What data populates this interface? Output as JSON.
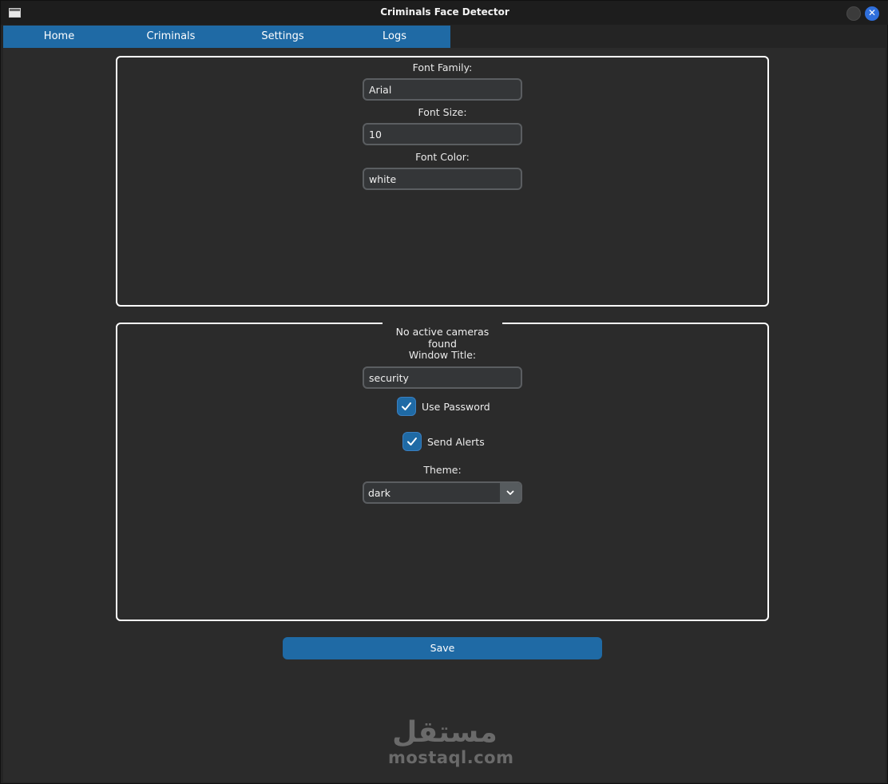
{
  "window": {
    "title": "Criminals Face Detector"
  },
  "tabs": [
    {
      "label": "Home"
    },
    {
      "label": "Criminals"
    },
    {
      "label": "Settings"
    },
    {
      "label": "Logs"
    }
  ],
  "font_settings": {
    "family_label": "Font Family:",
    "family_value": "Arial",
    "size_label": "Font Size:",
    "size_value": "10",
    "color_label": "Font Color:",
    "color_value": "white"
  },
  "camera_settings": {
    "status_text": "No active cameras found",
    "window_title_label": "Window Title:",
    "window_title_value": "security",
    "use_password_label": "Use Password",
    "use_password_checked": true,
    "send_alerts_label": "Send Alerts",
    "send_alerts_checked": true,
    "theme_label": "Theme:",
    "theme_value": "dark"
  },
  "save_label": "Save",
  "watermark": {
    "arabic": "مستقل",
    "latin": "mostaql.com"
  },
  "colors": {
    "accent": "#1f6aa5",
    "background": "#2b2b2b",
    "entry_bg": "#343638",
    "entry_border": "#5b5e61"
  }
}
